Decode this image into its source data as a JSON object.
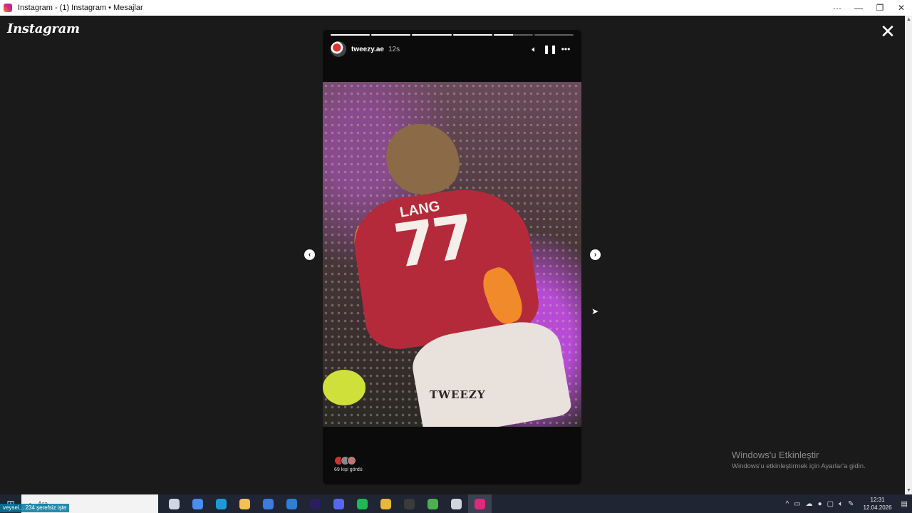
{
  "window": {
    "title": "Instagram - (1) Instagram • Mesajlar",
    "buttons": {
      "more": "···",
      "minimize": "—",
      "restore": "❐",
      "close": "✕"
    }
  },
  "brand": {
    "logo_text": "Instagram"
  },
  "story": {
    "username": "tweezy.ae",
    "time_ago": "12s",
    "progress_segments": [
      1,
      1,
      1,
      1,
      0.5,
      0
    ],
    "video": {
      "jersey_number": "77",
      "jersey_name": "LANG",
      "watermark": "TWEEZY"
    },
    "icons": {
      "sound": "sound-icon",
      "pause": "pause-icon",
      "more": "more-icon"
    },
    "viewers": {
      "count_text": "69 kişi gördü"
    }
  },
  "nav": {
    "prev": "‹",
    "next": "›"
  },
  "windows_activation": {
    "heading": "Windows'u Etkinleştir",
    "subtext": "Windows'u etkinleştirmek için Ayarlar'a gidin."
  },
  "taskbar": {
    "search_placeholder": "Ara",
    "status_overlay": "veysel... 234  şerefsiz işte",
    "apps": [
      {
        "name": "task-view",
        "color": "#cfd6e4"
      },
      {
        "name": "copilot",
        "color": "#4a8cf0"
      },
      {
        "name": "edge",
        "color": "#1e9bd7"
      },
      {
        "name": "file-explorer",
        "color": "#f2c14e"
      },
      {
        "name": "store",
        "color": "#3d7be0"
      },
      {
        "name": "outlook",
        "color": "#2f7fd6"
      },
      {
        "name": "after-effects",
        "color": "#2a1f5c"
      },
      {
        "name": "discord",
        "color": "#5865f2"
      },
      {
        "name": "spotify",
        "color": "#1db954"
      },
      {
        "name": "chrome",
        "color": "#e8b83a"
      },
      {
        "name": "obs",
        "color": "#3b3b3b"
      },
      {
        "name": "chrome-alt",
        "color": "#4caf50"
      },
      {
        "name": "toolbox",
        "color": "#d0d4dc"
      },
      {
        "name": "instagram",
        "color": "#dd2a7b"
      }
    ],
    "clock": {
      "time": "12:31",
      "date": "12.04.2026"
    }
  }
}
